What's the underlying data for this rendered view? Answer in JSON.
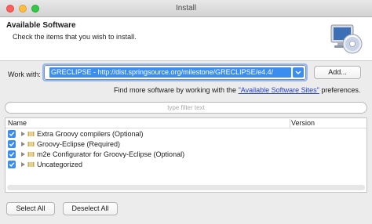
{
  "window": {
    "title": "Install"
  },
  "header": {
    "title": "Available Software",
    "subtitle": "Check the items that you wish to install."
  },
  "work_with": {
    "label": "Work with:",
    "value": "GRECLIPSE - http://dist.springsource.org/milestone/GRECLIPSE/e4.4/",
    "add_label": "Add..."
  },
  "find_more": {
    "prefix": "Find more software by working with the ",
    "link": "\"Available Software Sites\"",
    "suffix": " preferences."
  },
  "filter": {
    "placeholder": "type filter text"
  },
  "table": {
    "columns": [
      "Name",
      "Version"
    ],
    "rows": [
      {
        "label": "Extra Groovy compilers (Optional)",
        "checked": true
      },
      {
        "label": "Groovy-Eclipse (Required)",
        "checked": true
      },
      {
        "label": "m2e Configurator for Groovy-Eclipse (Optional)",
        "checked": true
      },
      {
        "label": "Uncategorized",
        "checked": true
      }
    ]
  },
  "buttons": {
    "select_all": "Select All",
    "deselect_all": "Deselect All"
  },
  "colors": {
    "accent": "#3b8ef0",
    "link": "#2440d8"
  },
  "icons": [
    "close-icon",
    "minimize-icon",
    "maximize-icon",
    "cd-install-icon",
    "dropdown-caret-icon",
    "checkbox-icon",
    "expand-triangle-icon",
    "package-icon"
  ]
}
